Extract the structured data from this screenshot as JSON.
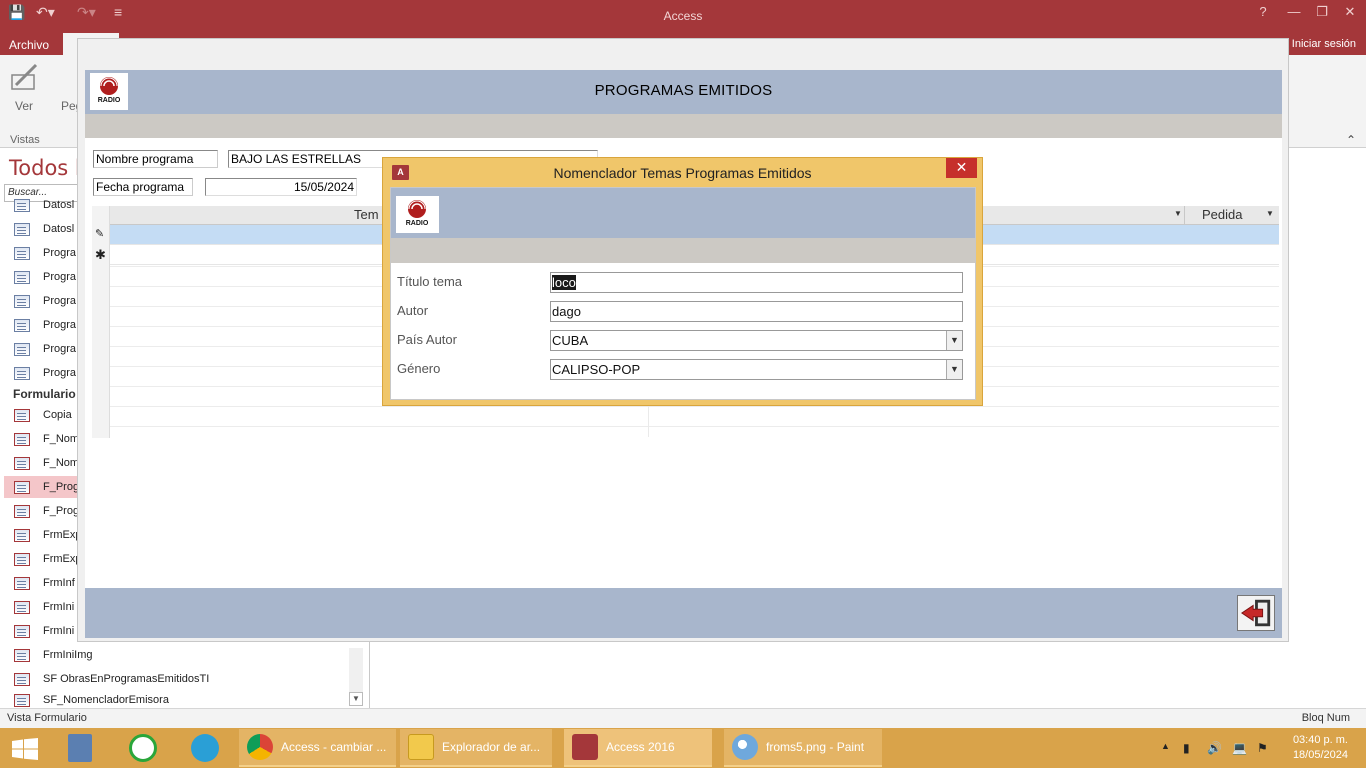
{
  "app": {
    "title": "Access",
    "file_tab": "Archivo",
    "signin": "Iniciar sesión",
    "help": "?"
  },
  "ribbon": {
    "ver_label": "Ver",
    "pe_label": "Peg",
    "group_label": "Vistas"
  },
  "nav": {
    "title": "Todos l",
    "search_placeholder": "Buscar...",
    "items_top": [
      "Datosl",
      "Datosl",
      "Progra",
      "Progra",
      "Progra",
      "Progra",
      "Progra",
      "Progra"
    ],
    "section_forms": "Formulario",
    "items_forms": [
      "Copia",
      "F_Nom",
      "F_Nom",
      "F_Prog",
      "F_Prog",
      "FrmExp",
      "FrmExp",
      "FrmInf",
      "FrmIni",
      "FrmIni",
      "FrmIniImg",
      "SF ObrasEnProgramasEmitidosTI",
      "SF_NomencladorEmisora"
    ]
  },
  "mainform": {
    "title": "PROGRAMAS EMITIDOS",
    "logo_text": "RADIO",
    "nombre_label": "Nombre programa",
    "nombre_value": "BAJO LAS ESTRELLAS",
    "fecha_label": "Fecha programa",
    "fecha_value": "15/05/2024",
    "col_tema": "Tem",
    "col_pedida": "Pedida"
  },
  "dialog": {
    "title": "Nomenclador Temas Programas Emitidos",
    "app_icon": "A",
    "logo_text": "RADIO",
    "fields": {
      "titulo_label": "Título tema",
      "titulo_value": "loco",
      "autor_label": "Autor",
      "autor_value": "dago",
      "pais_label": "País Autor",
      "pais_value": "CUBA",
      "genero_label": "Género",
      "genero_value": "CALIPSO-POP"
    }
  },
  "statusbar": {
    "left": "Vista Formulario",
    "right": "Bloq Num"
  },
  "taskbar": {
    "tasks": [
      "Access - cambiar ...",
      "Explorador de ar...",
      "Access 2016",
      "froms5.png - Paint"
    ],
    "time": "03:40 p. m.",
    "date": "18/05/2024"
  },
  "colors": {
    "accent": "#a4373a",
    "form_header": "#a8b6cc",
    "dialog_frame": "#f0c66a",
    "taskbar": "#d9a34a"
  }
}
